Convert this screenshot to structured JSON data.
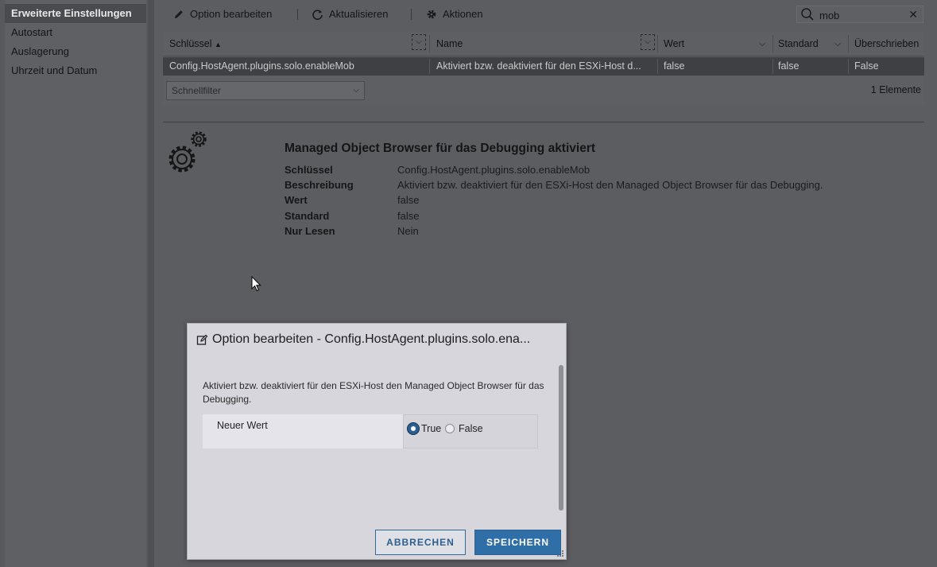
{
  "sidebar": {
    "items": [
      {
        "label": "Erweiterte Einstellungen"
      },
      {
        "label": "Autostart"
      },
      {
        "label": "Auslagerung"
      },
      {
        "label": "Uhrzeit und Datum"
      }
    ]
  },
  "toolbar": {
    "edit_label": "Option bearbeiten",
    "refresh_label": "Aktualisieren",
    "actions_label": "Aktionen",
    "search_value": "mob"
  },
  "grid": {
    "columns": [
      "Schlüssel",
      "Name",
      "Wert",
      "Standard",
      "Überschrieben"
    ],
    "sort_indicator": "▲",
    "rows": [
      [
        "Config.HostAgent.plugins.solo.enableMob",
        "Aktiviert bzw. deaktiviert für den ESXi-Host d...",
        "false",
        "false",
        "False"
      ]
    ],
    "filter_placeholder": "Schnellfilter",
    "count_label": "1 Elemente"
  },
  "details": {
    "title": "Managed Object Browser für das Debugging aktiviert",
    "fields": [
      {
        "label": "Schlüssel",
        "value": "Config.HostAgent.plugins.solo.enableMob"
      },
      {
        "label": "Beschreibung",
        "value": "Aktiviert bzw. deaktiviert für den ESXi-Host den Managed Object Browser für das Debugging."
      },
      {
        "label": "Wert",
        "value": "false"
      },
      {
        "label": "Standard",
        "value": "false"
      },
      {
        "label": "Nur Lesen",
        "value": "Nein"
      }
    ]
  },
  "modal": {
    "title": "Option bearbeiten - Config.HostAgent.plugins.solo.ena...",
    "description": "Aktiviert bzw. deaktiviert für den ESXi-Host den Managed Object Browser für das Debugging.",
    "field_label": "Neuer Wert",
    "options": [
      {
        "label": "True",
        "checked": true
      },
      {
        "label": "False",
        "checked": false
      }
    ],
    "cancel_label": "ABBRECHEN",
    "save_label": "SPEICHERN"
  },
  "colors": {
    "accent": "#2f6ea6",
    "selected_row": "#3f4044",
    "modal_bg": "#d6d6dc"
  }
}
